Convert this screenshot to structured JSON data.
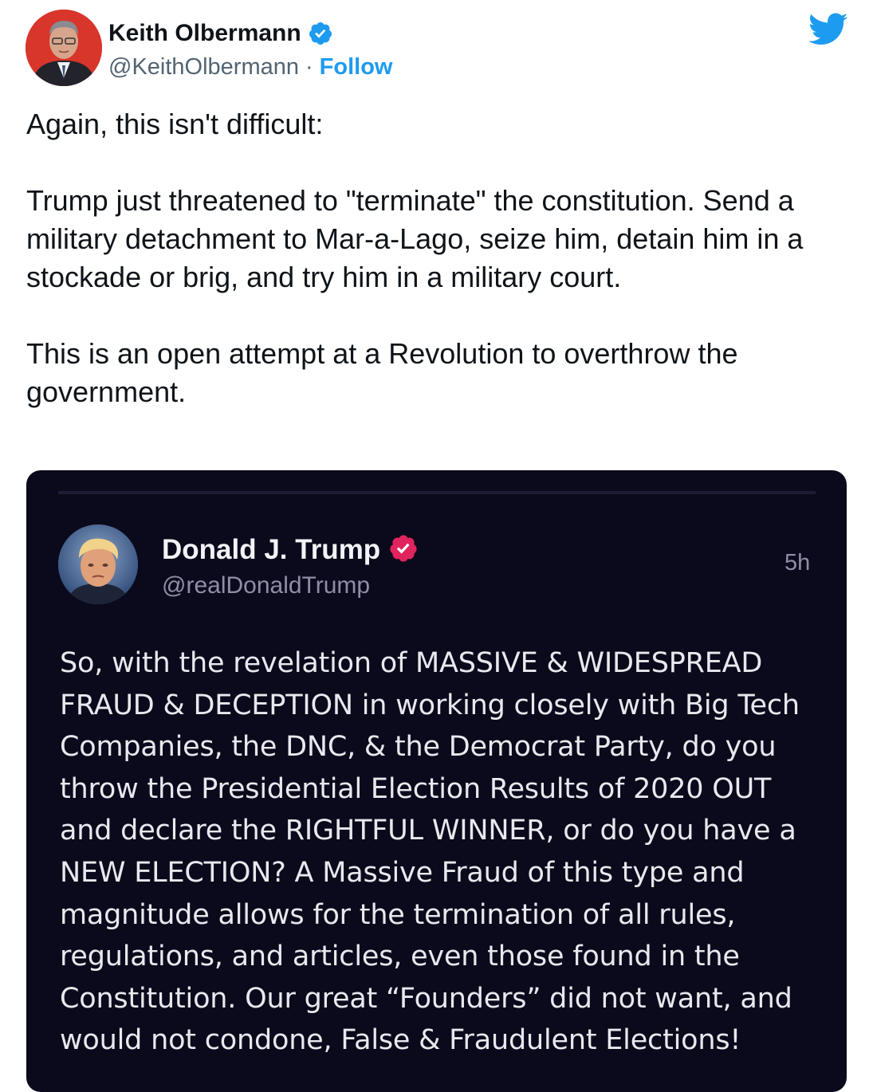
{
  "tweet": {
    "author": {
      "name": "Keith Olbermann",
      "handle": "@KeithOlbermann",
      "separator": "·",
      "follow_label": "Follow",
      "verified": true
    },
    "brand_icon": "twitter-bird-icon",
    "brand_color": "#1d9bf0",
    "text_paragraphs": [
      "Again, this isn't difficult:",
      "Trump just threatened to \"terminate\" the constitution. Send a military detachment to Mar-a-Lago, seize him, detain him in a stockade or brig, and try him in a military court.",
      "This is an open attempt at a Revolution to overthrow the government."
    ]
  },
  "embedded_post": {
    "author": {
      "name": "Donald J. Trump",
      "handle": "@realDonaldTrump",
      "verified_color": "#e0245e"
    },
    "time": "5h",
    "text": "So, with the revelation of MASSIVE & WIDESPREAD FRAUD & DECEPTION in working closely with Big Tech Companies, the DNC, & the Democrat Party, do you throw the Presidential Election Results of 2020 OUT and declare the RIGHTFUL WINNER, or do you have a NEW ELECTION? A Massive Fraud of this type and magnitude allows for the termination of all rules, regulations, and articles, even those found in the Constitution. Our great “Founders” did not want, and would not condone, False & Fraudulent Elections!"
  }
}
